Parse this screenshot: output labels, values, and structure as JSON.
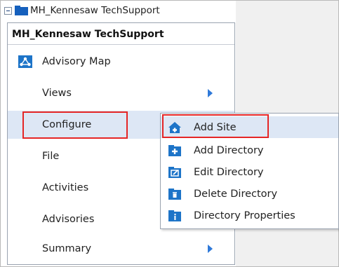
{
  "tree": {
    "node_label": "MH_Kennesaw TechSupport",
    "icons": [
      "collapse-icon",
      "folder-icon"
    ]
  },
  "context_menu": {
    "header": "MH_Kennesaw TechSupport",
    "items": [
      {
        "label": "Advisory Map",
        "icon": "map-icon"
      },
      {
        "label": "Views",
        "has_submenu": true
      },
      {
        "label": "Configure",
        "has_submenu": true
      },
      {
        "label": "File"
      },
      {
        "label": "Activities"
      },
      {
        "label": "Advisories"
      },
      {
        "label": "Summary",
        "has_submenu": true
      }
    ]
  },
  "submenu": {
    "items": [
      {
        "label": "Add Site",
        "icon": "add-site-icon"
      },
      {
        "label": "Add Directory",
        "icon": "add-directory-icon"
      },
      {
        "label": "Edit Directory",
        "icon": "edit-directory-icon"
      },
      {
        "label": "Delete Directory",
        "icon": "delete-directory-icon"
      },
      {
        "label": "Directory Properties",
        "icon": "directory-properties-icon"
      }
    ]
  },
  "colors": {
    "accent_blue": "#1d74c8",
    "highlight_bg": "#dde7f5",
    "annotation_red": "#e52626",
    "arrow_blue": "#2f79d9"
  }
}
